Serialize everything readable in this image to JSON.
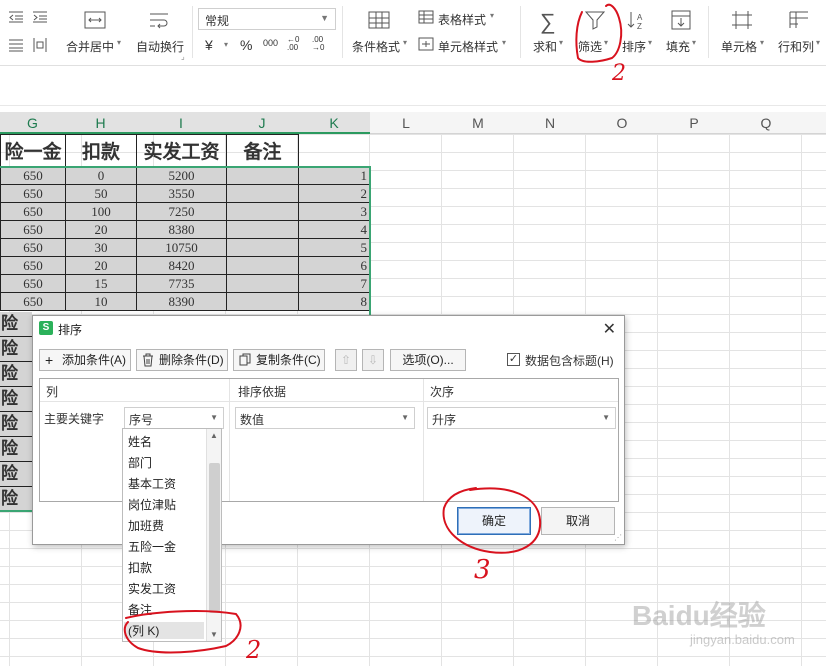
{
  "ribbon": {
    "merge_center": "合并居中",
    "wrap_text": "自动换行",
    "number_format": "常规",
    "currency": "¥",
    "percent": "%",
    "thousands": "000",
    "dec_inc": "←0 .00",
    "dec_dec": ".00 →0",
    "conditional_format": "条件格式",
    "table_style": "表格样式",
    "cell_style": "单元格样式",
    "sum": "求和",
    "filter": "筛选",
    "sort": "排序",
    "fill": "填充",
    "cell": "单元格",
    "rows_cols": "行和列"
  },
  "columns": [
    "G",
    "H",
    "I",
    "J",
    "K",
    "L",
    "M",
    "N",
    "O",
    "P",
    "Q"
  ],
  "table": {
    "headers": [
      "险一金",
      "扣款",
      "实发工资",
      "备注"
    ],
    "rows": [
      {
        "g": "650",
        "h": "0",
        "i": "5200",
        "j": "",
        "k": "1"
      },
      {
        "g": "650",
        "h": "50",
        "i": "3550",
        "j": "",
        "k": "2"
      },
      {
        "g": "650",
        "h": "100",
        "i": "7250",
        "j": "",
        "k": "3"
      },
      {
        "g": "650",
        "h": "20",
        "i": "8380",
        "j": "",
        "k": "4"
      },
      {
        "g": "650",
        "h": "30",
        "i": "10750",
        "j": "",
        "k": "5"
      },
      {
        "g": "650",
        "h": "20",
        "i": "8420",
        "j": "",
        "k": "6"
      },
      {
        "g": "650",
        "h": "15",
        "i": "7735",
        "j": "",
        "k": "7"
      },
      {
        "g": "650",
        "h": "10",
        "i": "8390",
        "j": "",
        "k": "8"
      }
    ],
    "left_partial": [
      "险",
      "险",
      "险",
      "险",
      "险",
      "险",
      "险",
      "险"
    ]
  },
  "dialog": {
    "title": "排序",
    "close": "✕",
    "add_condition": "添加条件(A)",
    "delete_condition": "删除条件(D)",
    "copy_condition": "复制条件(C)",
    "options": "选项(O)...",
    "header_checkbox": "数据包含标题(H)",
    "col_header": "列",
    "basis_header": "排序依据",
    "order_header": "次序",
    "primary_key": "主要关键字",
    "key_value": "序号",
    "basis_value": "数值",
    "order_value": "升序",
    "ok": "确定",
    "cancel": "取消"
  },
  "dropdown_list": [
    "姓名",
    "部门",
    "基本工资",
    "岗位津贴",
    "加班费",
    "五险一金",
    "扣款",
    "实发工资",
    "备注",
    "(列 K)"
  ],
  "watermark": {
    "logo": "Baidu经验",
    "url": "jingyan.baidu.com"
  },
  "annotations": [
    "2",
    "2",
    "3"
  ],
  "colors": {
    "accent_green": "#2b9a5f",
    "annotation_red": "#d8121e",
    "selected_cell_gray": "#d4d4d4"
  }
}
